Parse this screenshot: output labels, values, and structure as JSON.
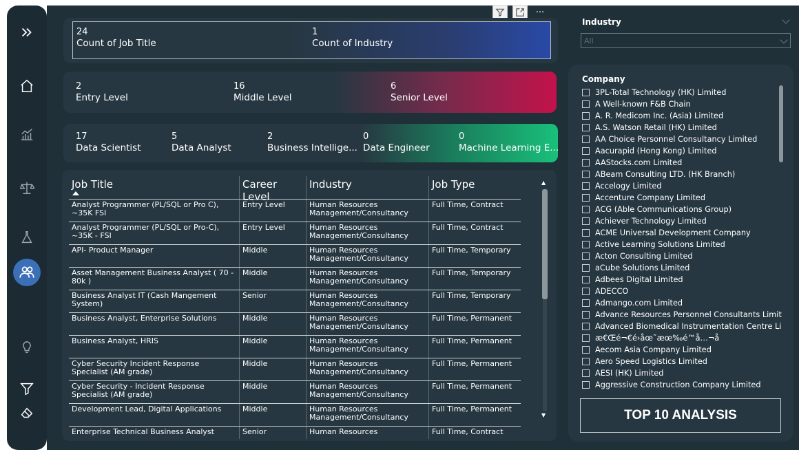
{
  "colors": {
    "canvas": "#1f3038",
    "card": "#273741",
    "accent_blue": "#2949a6",
    "accent_red": "#c3124b",
    "accent_green": "#19c07a",
    "nav_active": "#3b6fb7"
  },
  "nav": {
    "items": [
      {
        "icon": "expand-icon"
      },
      {
        "icon": "home-icon"
      },
      {
        "icon": "chart-icon"
      },
      {
        "icon": "balance-scale-icon"
      },
      {
        "icon": "flask-icon"
      },
      {
        "icon": "people-icon",
        "active": true
      },
      {
        "icon": "lightbulb-icon"
      },
      {
        "icon": "filter-icon"
      },
      {
        "icon": "eraser-icon"
      }
    ]
  },
  "visual_header": {
    "icons": [
      "filter-icon",
      "focus-mode-icon",
      "more-options-icon"
    ],
    "more_label": "···"
  },
  "kpi_row1": [
    {
      "value": "24",
      "label": "Count of Job Title"
    },
    {
      "value": "1",
      "label": "Count of Industry"
    }
  ],
  "kpi_row2": [
    {
      "value": "2",
      "label": "Entry Level"
    },
    {
      "value": "16",
      "label": "Middle Level"
    },
    {
      "value": "6",
      "label": "Senior Level"
    }
  ],
  "kpi_row3": [
    {
      "value": "17",
      "label": "Data Scientist"
    },
    {
      "value": "5",
      "label": "Data Analyst"
    },
    {
      "value": "2",
      "label": "Business Intellige..."
    },
    {
      "value": "0",
      "label": "Data Engineer"
    },
    {
      "value": "0",
      "label": "Machine Learning E..."
    }
  ],
  "table": {
    "headers": [
      "Job Title",
      "Career Level",
      "Industry",
      "Job Type"
    ],
    "rows": [
      [
        "Analyst Programmer (PL/SQL or Pro C), ~35K FSI",
        "Entry Level",
        "Human Resources Management/Consultancy",
        "Full Time, Contract"
      ],
      [
        "Analyst Programmer (PL/SQL or Pro-C), ~35K - FSI",
        "Entry Level",
        "Human Resources Management/Consultancy",
        "Full Time, Contract"
      ],
      [
        "API- Product Manager",
        "Middle",
        "Human Resources Management/Consultancy",
        "Full Time, Temporary"
      ],
      [
        "Asset Management Business Analyst ( 70 - 80k )",
        "Middle",
        "Human Resources Management/Consultancy",
        "Full Time, Temporary"
      ],
      [
        "Business Analyst IT (Cash Mangement System)",
        "Senior",
        "Human Resources Management/Consultancy",
        "Full Time, Temporary"
      ],
      [
        "Business Analyst, Enterprise Solutions",
        "Middle",
        "Human Resources Management/Consultancy",
        "Full Time, Permanent"
      ],
      [
        "Business Analyst, HRIS",
        "Middle",
        "Human Resources Management/Consultancy",
        "Full Time, Permanent"
      ],
      [
        "Cyber Security Incident Response Specialist (AM grade)",
        "Middle",
        "Human Resources Management/Consultancy",
        "Full Time, Permanent"
      ],
      [
        "Cyber Security - Incident Response Specialist (AM grade)",
        "Middle",
        "Human Resources Management/Consultancy",
        "Full Time, Permanent"
      ],
      [
        "Development Lead, Digital Applications",
        "Middle",
        "Human Resources Management/Consultancy",
        "Full Time, Permanent"
      ],
      [
        "Enterprise Technical Business Analyst",
        "Senior",
        "Human Resources",
        "Full Time, Contract"
      ]
    ]
  },
  "industry_slicer": {
    "title": "Industry",
    "value": "All"
  },
  "company_slicer": {
    "title": "Company",
    "items": [
      "3PL-Total Technology (HK) Limited",
      "A Well-known F&B Chain",
      "A. R. Medicom Inc. (Asia) Limited",
      "A.S. Watson Retail (HK) Limited",
      "AA Choice Personnel Consultancy Limited",
      "Aacurapid (Hong Kong) Limited",
      "AAStocks.com Limited",
      "ABeam Consulting LTD. (HK Branch)",
      "Accelogy Limited",
      "Accenture Company Limited",
      "ACG (Able Communications Group)",
      "Achiever Technology Limited",
      "ACME Universal Development Company",
      "Active Learning Solutions Limited",
      "Acton Consulting Limited",
      "aCube Solutions Limited",
      "Adbees Digital Limited",
      "ADECCO",
      "Admango.com Limited",
      "Advance Resources Personnel Consultants Limited",
      "Advanced Biomedical Instrumentation Centre Lim...",
      "æ€Œé¬€é›åœ˜æœ‰é™å…¬å",
      "Aecom Asia Company Limited",
      "Aero Speed Logistics Limited",
      "AESI (HK) Limited",
      "Aggressive Construction Company Limited"
    ]
  },
  "top10_button": {
    "label": "TOP 10 ANALYSIS"
  }
}
